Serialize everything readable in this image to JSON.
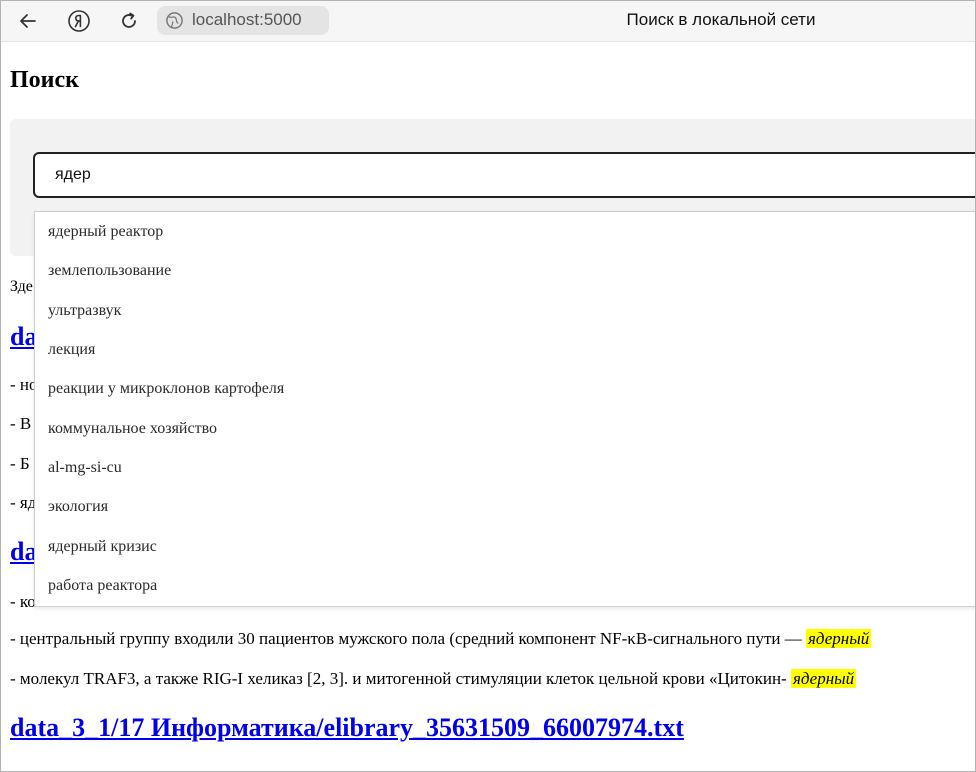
{
  "browser": {
    "url": "localhost:5000",
    "tab_title": "Поиск в локальной сети"
  },
  "page": {
    "title": "Поиск"
  },
  "search": {
    "value": "ядер",
    "suggestions": [
      "ядерный реактор",
      "землепользование",
      "ультразвук",
      "лекция",
      "реакции у микроклонов картофеля",
      "коммунальное хозяйство",
      "al-mg-si-cu",
      "экология",
      "ядерный кризис",
      "работа реактора"
    ]
  },
  "results": {
    "summary_prefix": "Зде",
    "result1_title_prefix": "da",
    "result1_snippets": [
      "- но",
      "- В",
      "- Б",
      "- яд"
    ],
    "result2_title_prefix": "da",
    "result2_snippets": [
      {
        "text": "- ко",
        "hl": ""
      },
      {
        "text": "- центральный группу входили 30 пациентов мужского пола (средний компонент NF-κB-сигнального пути — ",
        "hl": "ядерный"
      },
      {
        "text": "- молекул TRAF3, а также RIG-I хеликаз [2, 3]. и митогенной стимуляции клеток цельной крови «Цитокин- ",
        "hl": "ядерный"
      }
    ],
    "result3_title": "data_3_1/17 Информатика/elibrary_35631509_66007974.txt"
  }
}
